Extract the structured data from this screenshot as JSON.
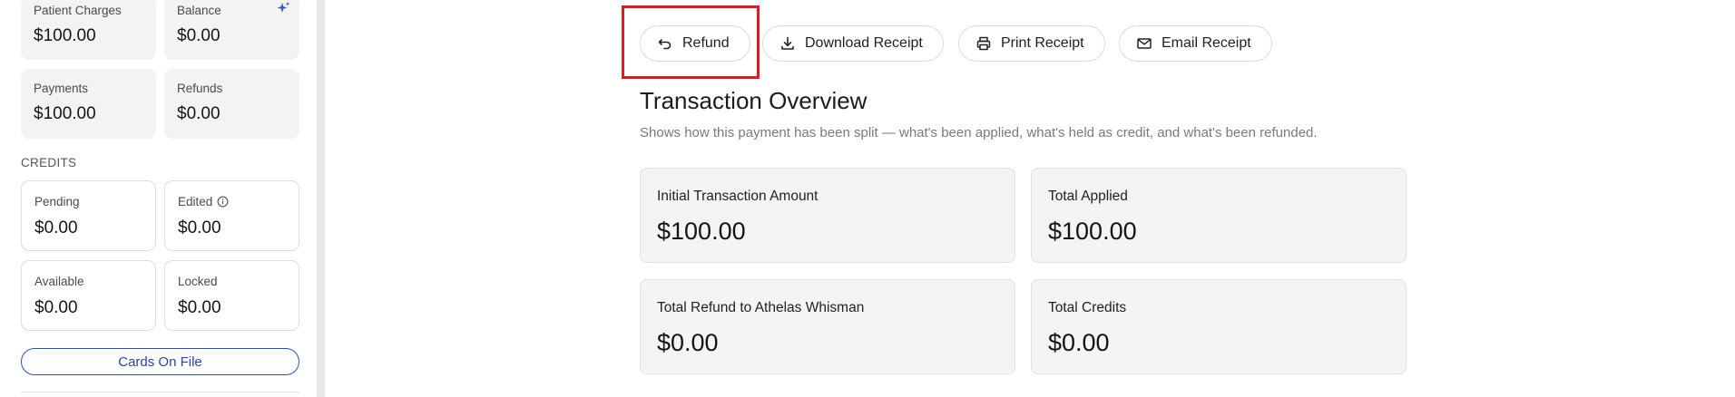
{
  "summary": {
    "patient_charges": {
      "label": "Patient Charges",
      "value": "$100.00"
    },
    "balance": {
      "label": "Balance",
      "value": "$0.00"
    },
    "payments": {
      "label": "Payments",
      "value": "$100.00"
    },
    "refunds": {
      "label": "Refunds",
      "value": "$0.00"
    }
  },
  "credits": {
    "section_label": "CREDITS",
    "pending": {
      "label": "Pending",
      "value": "$0.00"
    },
    "edited": {
      "label": "Edited",
      "value": "$0.00"
    },
    "available": {
      "label": "Available",
      "value": "$0.00"
    },
    "locked": {
      "label": "Locked",
      "value": "$0.00"
    }
  },
  "cards_on_file_label": "Cards On File",
  "actions": {
    "refund": "Refund",
    "download_receipt": "Download Receipt",
    "print_receipt": "Print Receipt",
    "email_receipt": "Email Receipt"
  },
  "overview": {
    "title": "Transaction Overview",
    "subtitle": "Shows how this payment has been split — what's been applied, what's held as credit, and what's been refunded.",
    "cards": [
      {
        "label": "Initial Transaction Amount",
        "value": "$100.00"
      },
      {
        "label": "Total Applied",
        "value": "$100.00"
      },
      {
        "label": "Total Refund to Athelas Whisman",
        "value": "$0.00"
      },
      {
        "label": "Total Credits",
        "value": "$0.00"
      }
    ]
  },
  "colors": {
    "accent": "#2f4fb8",
    "highlight": "#d62027",
    "card_bg": "#f3f3f3"
  }
}
